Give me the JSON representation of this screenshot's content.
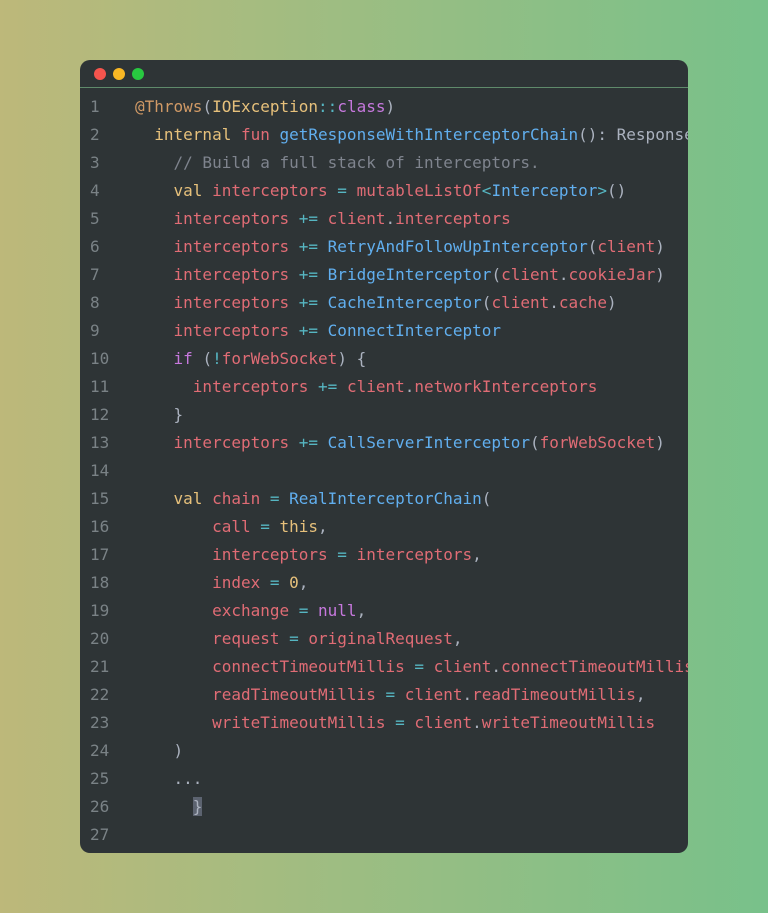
{
  "window": {
    "controls": [
      "close",
      "minimize",
      "maximize"
    ]
  },
  "code": {
    "lines": [
      {
        "n": "1",
        "indent": "",
        "tokens": [
          [
            "ann",
            "@Throws"
          ],
          [
            "pn",
            "("
          ],
          [
            "kw",
            "IOException"
          ],
          [
            "op",
            "::"
          ],
          [
            "pl",
            "class"
          ],
          [
            "pn",
            ")"
          ]
        ]
      },
      {
        "n": "2",
        "indent": "  ",
        "tokens": [
          [
            "kw",
            "internal "
          ],
          [
            "kw2",
            "fun "
          ],
          [
            "fn",
            "getResponseWithInterceptorChain"
          ],
          [
            "pn",
            "(): Response {"
          ]
        ]
      },
      {
        "n": "3",
        "indent": "    ",
        "tokens": [
          [
            "cm",
            "// Build a full stack of interceptors."
          ]
        ]
      },
      {
        "n": "4",
        "indent": "    ",
        "tokens": [
          [
            "kw",
            "val "
          ],
          [
            "var",
            "interceptors "
          ],
          [
            "op",
            "= "
          ],
          [
            "var",
            "mutableListOf"
          ],
          [
            "op",
            "<"
          ],
          [
            "cls",
            "Interceptor"
          ],
          [
            "op",
            ">"
          ],
          [
            "pn",
            "()"
          ]
        ]
      },
      {
        "n": "5",
        "indent": "    ",
        "tokens": [
          [
            "var",
            "interceptors "
          ],
          [
            "op",
            "+= "
          ],
          [
            "var",
            "client"
          ],
          [
            "pn",
            "."
          ],
          [
            "var",
            "interceptors"
          ]
        ]
      },
      {
        "n": "6",
        "indent": "    ",
        "tokens": [
          [
            "var",
            "interceptors "
          ],
          [
            "op",
            "+= "
          ],
          [
            "fn",
            "RetryAndFollowUpInterceptor"
          ],
          [
            "pn",
            "("
          ],
          [
            "var",
            "client"
          ],
          [
            "pn",
            ")"
          ]
        ]
      },
      {
        "n": "7",
        "indent": "    ",
        "tokens": [
          [
            "var",
            "interceptors "
          ],
          [
            "op",
            "+= "
          ],
          [
            "fn",
            "BridgeInterceptor"
          ],
          [
            "pn",
            "("
          ],
          [
            "var",
            "client"
          ],
          [
            "pn",
            "."
          ],
          [
            "var",
            "cookieJar"
          ],
          [
            "pn",
            ")"
          ]
        ]
      },
      {
        "n": "8",
        "indent": "    ",
        "tokens": [
          [
            "var",
            "interceptors "
          ],
          [
            "op",
            "+= "
          ],
          [
            "fn",
            "CacheInterceptor"
          ],
          [
            "pn",
            "("
          ],
          [
            "var",
            "client"
          ],
          [
            "pn",
            "."
          ],
          [
            "var",
            "cache"
          ],
          [
            "pn",
            ")"
          ]
        ]
      },
      {
        "n": "9",
        "indent": "    ",
        "tokens": [
          [
            "var",
            "interceptors "
          ],
          [
            "op",
            "+= "
          ],
          [
            "fn",
            "ConnectInterceptor"
          ]
        ]
      },
      {
        "n": "10",
        "indent": "    ",
        "tokens": [
          [
            "pl",
            "if "
          ],
          [
            "pn",
            "("
          ],
          [
            "op",
            "!"
          ],
          [
            "var",
            "forWebSocket"
          ],
          [
            "pn",
            ") {"
          ]
        ]
      },
      {
        "n": "11",
        "indent": "      ",
        "tokens": [
          [
            "var",
            "interceptors "
          ],
          [
            "op",
            "+= "
          ],
          [
            "var",
            "client"
          ],
          [
            "pn",
            "."
          ],
          [
            "var",
            "networkInterceptors"
          ]
        ]
      },
      {
        "n": "12",
        "indent": "    ",
        "tokens": [
          [
            "pn",
            "}"
          ]
        ]
      },
      {
        "n": "13",
        "indent": "    ",
        "tokens": [
          [
            "var",
            "interceptors "
          ],
          [
            "op",
            "+= "
          ],
          [
            "fn",
            "CallServerInterceptor"
          ],
          [
            "pn",
            "("
          ],
          [
            "var",
            "forWebSocket"
          ],
          [
            "pn",
            ")"
          ]
        ]
      },
      {
        "n": "14",
        "indent": "",
        "tokens": []
      },
      {
        "n": "15",
        "indent": "    ",
        "tokens": [
          [
            "kw",
            "val "
          ],
          [
            "var",
            "chain "
          ],
          [
            "op",
            "= "
          ],
          [
            "fn",
            "RealInterceptorChain"
          ],
          [
            "pn",
            "("
          ]
        ]
      },
      {
        "n": "16",
        "indent": "        ",
        "tokens": [
          [
            "var",
            "call "
          ],
          [
            "op",
            "= "
          ],
          [
            "kw",
            "this"
          ],
          [
            "pn",
            ","
          ]
        ]
      },
      {
        "n": "17",
        "indent": "        ",
        "tokens": [
          [
            "var",
            "interceptors "
          ],
          [
            "op",
            "= "
          ],
          [
            "var",
            "interceptors"
          ],
          [
            "pn",
            ","
          ]
        ]
      },
      {
        "n": "18",
        "indent": "        ",
        "tokens": [
          [
            "var",
            "index "
          ],
          [
            "op",
            "= "
          ],
          [
            "num",
            "0"
          ],
          [
            "pn",
            ","
          ]
        ]
      },
      {
        "n": "19",
        "indent": "        ",
        "tokens": [
          [
            "var",
            "exchange "
          ],
          [
            "op",
            "= "
          ],
          [
            "pl",
            "null"
          ],
          [
            "pn",
            ","
          ]
        ]
      },
      {
        "n": "20",
        "indent": "        ",
        "tokens": [
          [
            "var",
            "request "
          ],
          [
            "op",
            "= "
          ],
          [
            "var",
            "originalRequest"
          ],
          [
            "pn",
            ","
          ]
        ]
      },
      {
        "n": "21",
        "indent": "        ",
        "tokens": [
          [
            "var",
            "connectTimeoutMillis "
          ],
          [
            "op",
            "= "
          ],
          [
            "var",
            "client"
          ],
          [
            "pn",
            "."
          ],
          [
            "var",
            "connectTimeoutMillis"
          ],
          [
            "pn",
            ","
          ]
        ]
      },
      {
        "n": "22",
        "indent": "        ",
        "tokens": [
          [
            "var",
            "readTimeoutMillis "
          ],
          [
            "op",
            "= "
          ],
          [
            "var",
            "client"
          ],
          [
            "pn",
            "."
          ],
          [
            "var",
            "readTimeoutMillis"
          ],
          [
            "pn",
            ","
          ]
        ]
      },
      {
        "n": "23",
        "indent": "        ",
        "tokens": [
          [
            "var",
            "writeTimeoutMillis "
          ],
          [
            "op",
            "= "
          ],
          [
            "var",
            "client"
          ],
          [
            "pn",
            "."
          ],
          [
            "var",
            "writeTimeoutMillis"
          ]
        ]
      },
      {
        "n": "24",
        "indent": "    ",
        "tokens": [
          [
            "pn",
            ")"
          ]
        ]
      },
      {
        "n": "25",
        "indent": "    ",
        "tokens": [
          [
            "pn",
            "..."
          ]
        ]
      },
      {
        "n": "26",
        "indent": "      ",
        "tokens": [
          [
            "cursor",
            "}"
          ]
        ]
      },
      {
        "n": "27",
        "indent": "",
        "tokens": []
      }
    ]
  },
  "colors": {
    "background_left": "#bdb87a",
    "background_right": "#78c18a",
    "editor_bg": "#2e3436"
  }
}
